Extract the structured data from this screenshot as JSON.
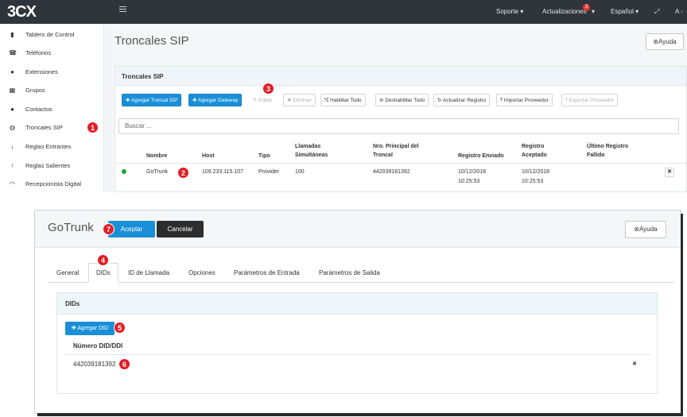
{
  "topbar": {
    "logo": "3CX",
    "nav": [
      "Soporte ▾",
      "Actualizaciones",
      "▾",
      "Español ▾",
      "⤢",
      "A -"
    ],
    "notif_count": "3"
  },
  "sidebar": {
    "items": [
      {
        "label": "Tablero de Control",
        "icon": "bar-chart-icon"
      },
      {
        "label": "Teléfonos",
        "icon": "phone-icon"
      },
      {
        "label": "Extensiones",
        "icon": "user-icon"
      },
      {
        "label": "Grupos",
        "icon": "grid-icon"
      },
      {
        "label": "Contactos",
        "icon": "contact-icon"
      },
      {
        "label": "Troncales SIP",
        "icon": "globe-icon"
      },
      {
        "label": "Reglas Entrantes",
        "icon": "arrow-down-icon"
      },
      {
        "label": "Reglas Salientes",
        "icon": "arrow-up-icon"
      },
      {
        "label": "Recepcionista Digital",
        "icon": "headset-icon"
      }
    ]
  },
  "page": {
    "title": "Troncales SIP",
    "help": "Ayuda",
    "panel_title": "Troncales SIP"
  },
  "toolbar": {
    "add_trunk": "✚ Agregar Troncal SIP",
    "add_gateway": "✚ Agregar Gateway",
    "edit": "✎ Editar",
    "delete": "✖ Eliminar",
    "enable_all": "⤭ Habilitar Todo",
    "disable_all": "⊘ Deshabilitar Todo",
    "refresh": "↻ Actualizar Registro",
    "import": "⤒ Importar Proveedor",
    "export": "⤒ Exportar Proveedor"
  },
  "search": {
    "placeholder": "Buscar ..."
  },
  "table": {
    "headers": {
      "nombre": "Nombre",
      "host": "Host",
      "tipo": "Tipo",
      "llamadas": "Llamadas",
      "llamadas2": "Simultáneas",
      "nro": "Nro. Principal del",
      "nro2": "Troncal",
      "reg_env": "Registro Enviado",
      "reg_acep": "Registro",
      "reg_acep2": "Aceptado",
      "ult": "Último Registro",
      "ult2": "Fallido"
    },
    "row": {
      "nombre": "GoTrunk",
      "host": "109.233.115.107",
      "tipo": "Provider",
      "llamadas": "100",
      "nro": "442039181392",
      "env_date": "10/12/2018",
      "env_time": "10:25:53",
      "acep_date": "10/12/2018",
      "acep_time": "10:25:53",
      "del": "✖"
    }
  },
  "dialog": {
    "title": "GoTrunk",
    "accept": "Aceptar",
    "cancel": "Cancelar",
    "help": "Ayuda",
    "tabs": [
      "General",
      "DIDs",
      "ID de Llamada",
      "Opciones",
      "Parámetros de Entrada",
      "Parámetros de Salida"
    ],
    "panel_title": "DIDs",
    "add_did": "✚ Agregar DID",
    "col_header": "Número DID/DDI",
    "did_value": "442039181392",
    "del": "✖"
  },
  "badges": [
    "1",
    "2",
    "3",
    "4",
    "5",
    "6",
    "7"
  ],
  "colors": {
    "accent": "#1a8fd8",
    "badge": "#e31e24",
    "topbar": "#2f353b",
    "status_ok": "#1ea540"
  }
}
